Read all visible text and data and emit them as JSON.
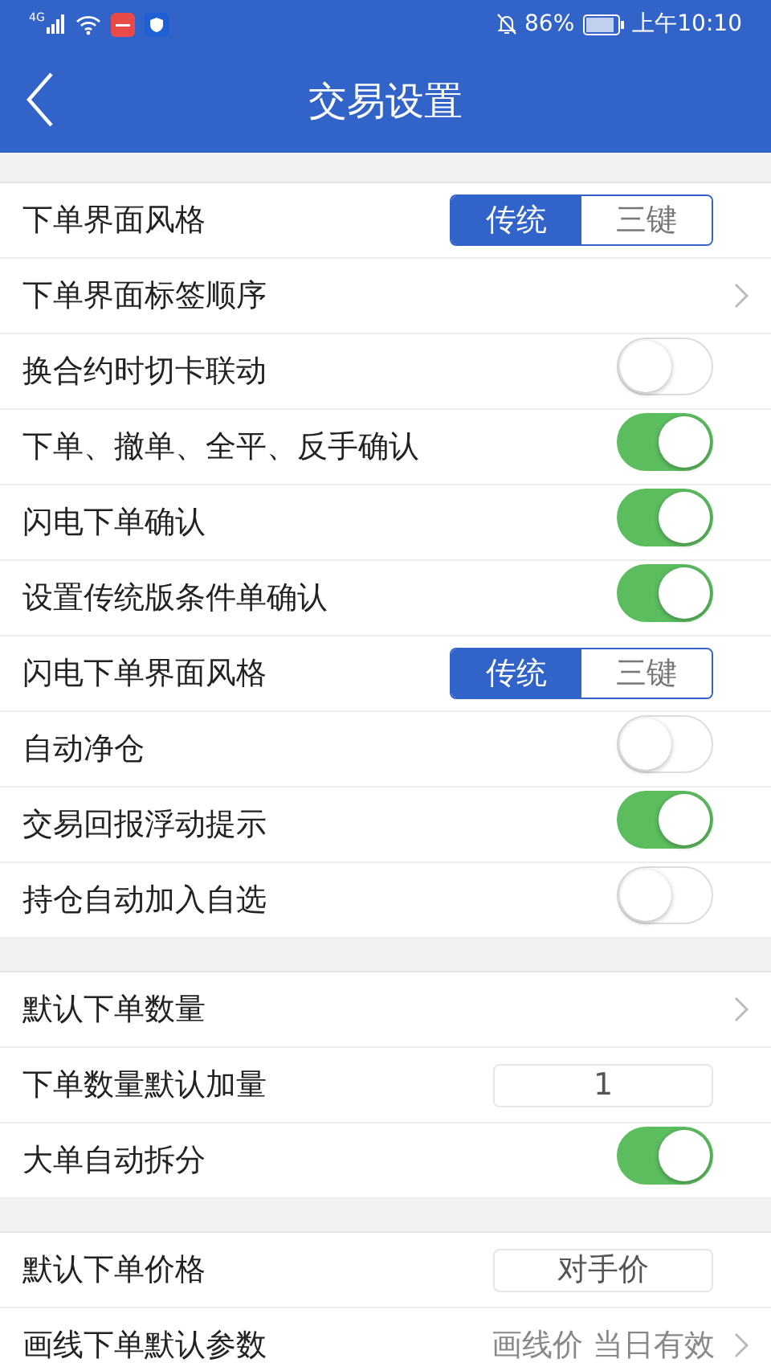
{
  "status_bar": {
    "network": "4G",
    "battery": "86%",
    "time": "上午10:10"
  },
  "header": {
    "title": "交易设置"
  },
  "sections": [
    {
      "rows": [
        {
          "kind": "segmented",
          "label": "下单界面风格",
          "options": [
            {
              "label": "传统",
              "selected": true
            },
            {
              "label": "三键",
              "selected": false
            }
          ]
        },
        {
          "kind": "link",
          "label": "下单界面标签顺序"
        },
        {
          "kind": "toggle",
          "label": "换合约时切卡联动",
          "on": false
        },
        {
          "kind": "toggle",
          "label": "下单、撤单、全平、反手确认",
          "on": true
        },
        {
          "kind": "toggle",
          "label": "闪电下单确认",
          "on": true
        },
        {
          "kind": "toggle",
          "label": "设置传统版条件单确认",
          "on": true
        },
        {
          "kind": "segmented",
          "label": "闪电下单界面风格",
          "options": [
            {
              "label": "传统",
              "selected": true
            },
            {
              "label": "三键",
              "selected": false
            }
          ]
        },
        {
          "kind": "toggle",
          "label": "自动净仓",
          "on": false
        },
        {
          "kind": "toggle",
          "label": "交易回报浮动提示",
          "on": true
        },
        {
          "kind": "toggle",
          "label": "持仓自动加入自选",
          "on": false
        }
      ]
    },
    {
      "rows": [
        {
          "kind": "link",
          "label": "默认下单数量"
        },
        {
          "kind": "field",
          "label": "下单数量默认加量",
          "value": "1"
        },
        {
          "kind": "toggle",
          "label": "大单自动拆分",
          "on": true
        }
      ]
    },
    {
      "rows": [
        {
          "kind": "field",
          "label": "默认下单价格",
          "value": "对手价"
        },
        {
          "kind": "link",
          "label": "画线下单默认参数",
          "value": "画线价  当日有效"
        }
      ]
    }
  ]
}
